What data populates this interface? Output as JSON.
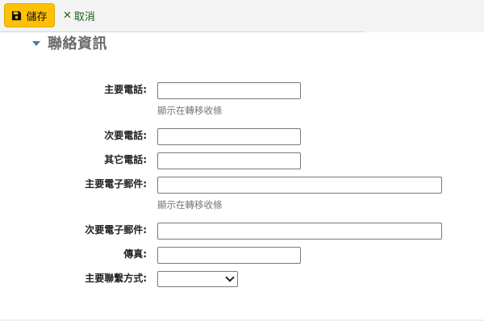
{
  "toolbar": {
    "save_label": "儲存",
    "cancel_label": "取消",
    "save_icon": "floppy-disk-icon",
    "cancel_icon": "x-icon"
  },
  "section": {
    "title": "聯絡資訊",
    "caret_icon": "caret-down-icon"
  },
  "form": {
    "primary_phone_label": "主要電話:",
    "primary_phone_value": "",
    "primary_phone_hint": "顯示在轉移收條",
    "secondary_phone_label": "次要電話:",
    "secondary_phone_value": "",
    "other_phone_label": "其它電話:",
    "other_phone_value": "",
    "primary_email_label": "主要電子郵件:",
    "primary_email_value": "",
    "primary_email_hint": "顯示在轉移收條",
    "secondary_email_label": "次要電子郵件:",
    "secondary_email_value": "",
    "fax_label": "傳真:",
    "fax_value": "",
    "primary_contact_label": "主要聯繫方式:",
    "primary_contact_selected": ""
  },
  "colors": {
    "save_button": "#ffc107",
    "cancel_text": "#1a5e1a",
    "caret": "#4a7aa6",
    "section_title": "#6b6b6b"
  }
}
